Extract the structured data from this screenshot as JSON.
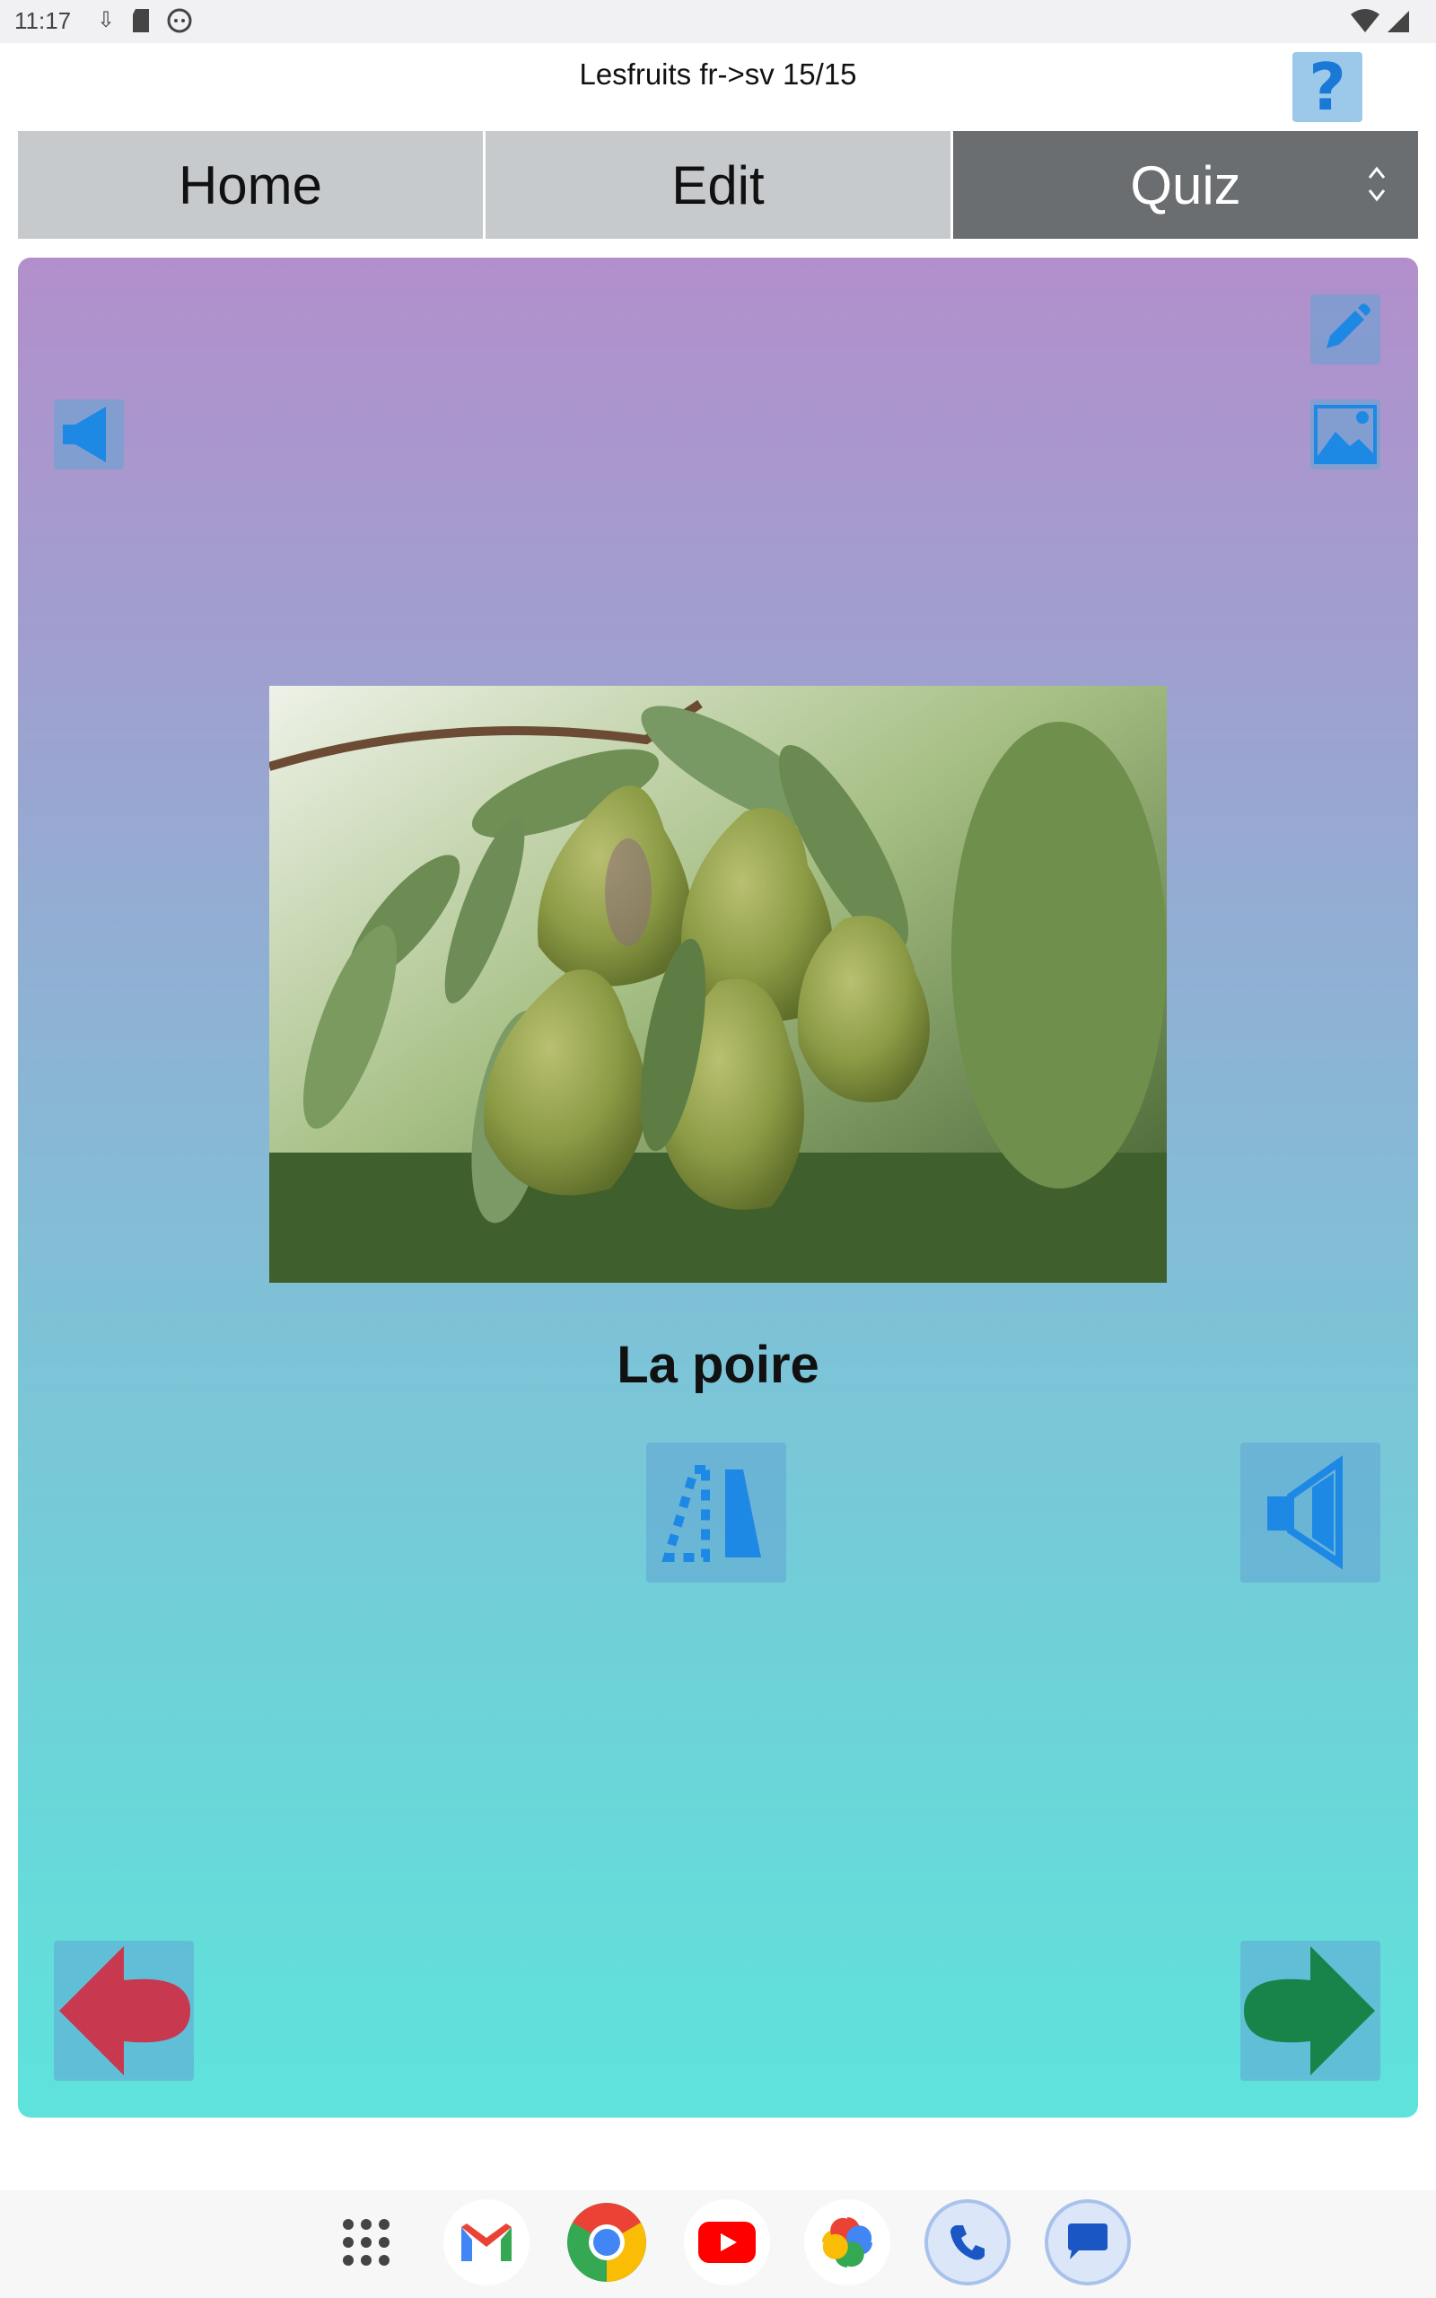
{
  "status": {
    "time": "11:17",
    "icons_left": [
      "download-icon",
      "sd-card-icon",
      "face-icon"
    ],
    "icons_right": [
      "wifi-icon",
      "signal-icon"
    ]
  },
  "header": {
    "title": "Lesfruits fr->sv 15/15",
    "help_label": "?"
  },
  "tabs": [
    {
      "label": "Home",
      "active": false
    },
    {
      "label": "Edit",
      "active": false
    },
    {
      "label": "Quiz",
      "active": true
    }
  ],
  "card": {
    "word": "La poire",
    "image_description": "pears-on-branch",
    "colors": {
      "gradient_top": "#b28fcc",
      "gradient_bottom": "#5ee3dc",
      "icon_blue": "#1e88e5",
      "back_arrow": "#c8384e",
      "next_arrow": "#17854a"
    }
  },
  "dock": {
    "apps": [
      "app-drawer-icon",
      "gmail-icon",
      "chrome-icon",
      "youtube-icon",
      "photos-icon",
      "phone-icon",
      "messages-icon"
    ]
  }
}
